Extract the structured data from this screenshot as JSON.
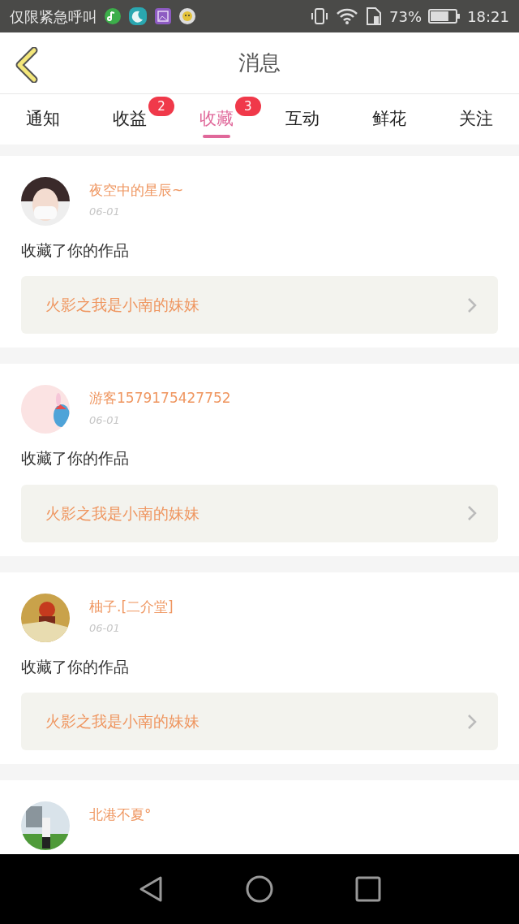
{
  "status_bar": {
    "carrier": "仅限紧急呼叫",
    "battery_percent": "73%",
    "time": "18:21"
  },
  "header": {
    "title": "消息"
  },
  "tabs": [
    {
      "label": "通知",
      "selected": false
    },
    {
      "label": "收益",
      "selected": false,
      "badge": "2"
    },
    {
      "label": "收藏",
      "selected": true,
      "badge": "3"
    },
    {
      "label": "互动",
      "selected": false
    },
    {
      "label": "鲜花",
      "selected": false
    },
    {
      "label": "关注",
      "selected": false
    }
  ],
  "messages": [
    {
      "user": "夜空中的星辰~",
      "date": "06-01",
      "action": "收藏了你的作品",
      "work": "火影之我是小南的妹妹"
    },
    {
      "user": "游客1579175427752",
      "date": "06-01",
      "action": "收藏了你的作品",
      "work": "火影之我是小南的妹妹"
    },
    {
      "user": "柚子.[二介堂]",
      "date": "06-01",
      "action": "收藏了你的作品",
      "work": "火影之我是小南的妹妹"
    },
    {
      "user": "北港不夏°"
    }
  ]
}
